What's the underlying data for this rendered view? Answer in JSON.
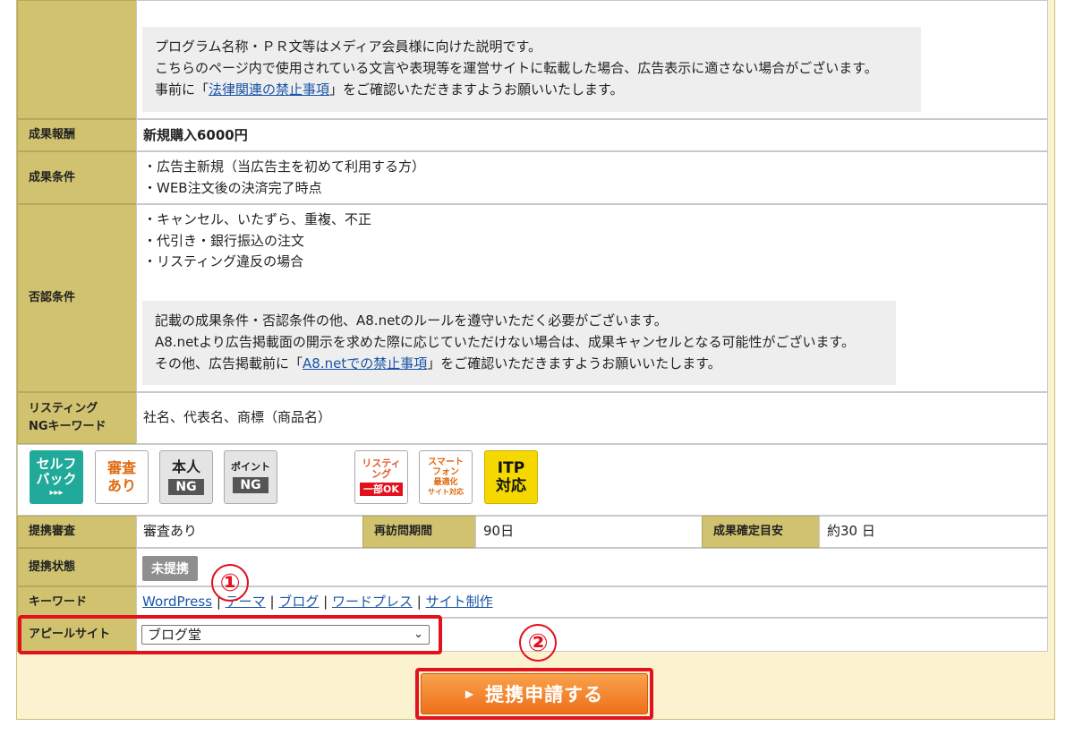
{
  "program_note": {
    "line1": "プログラム名称・ＰＲ文等はメディア会員様に向けた説明です。",
    "line2": "こちらのページ内で使用されている文言や表現等を運営サイトに転載した場合、広告表示に適さない場合がございます。",
    "line3_pre": "事前に「",
    "line3_link": "法律関連の禁止事項",
    "line3_post": "」をご確認いただきますようお願いいたします。"
  },
  "reward": {
    "label": "成果報酬",
    "value": "新規購入6000円"
  },
  "conditions": {
    "label": "成果条件",
    "items": [
      "・広告主新規（当広告主を初めて利用する方）",
      "・WEB注文後の決済完了時点"
    ]
  },
  "rejection": {
    "label": "否認条件",
    "items": [
      "・キャンセル、いたずら、重複、不正",
      "・代引き・銀行振込の注文",
      "・リスティング違反の場合"
    ],
    "note_line1": "記載の成果条件・否認条件の他、A8.netのルールを遵守いただく必要がございます。",
    "note_line2": "A8.netより広告掲載面の開示を求めた際に応じていただけない場合は、成果キャンセルとなる可能性がございます。",
    "note_line3_pre": "その他、広告掲載前に「",
    "note_line3_link": "A8.netでの禁止事項",
    "note_line3_post": "」をご確認いただきますようお願いいたします。"
  },
  "listing_ng": {
    "label_line1": "リスティング",
    "label_line2": "NGキーワード",
    "value": "社名、代表名、商標（商品名）"
  },
  "icons": {
    "selfback": [
      "セルフ",
      "バック",
      "▸▸▸"
    ],
    "review": [
      "審査",
      "あり"
    ],
    "self_ng": [
      "本人",
      "NG"
    ],
    "point_ng": [
      "ポイント",
      "NG"
    ],
    "listing_partial": [
      "リスティ",
      "ング",
      "一部OK"
    ],
    "smartphone": [
      "スマート",
      "フォン",
      "最適化",
      "サイト対応"
    ],
    "itp": [
      "ITP",
      "対応"
    ]
  },
  "terms": {
    "review_label": "提携審査",
    "review_value": "審査あり",
    "revisit_label": "再訪問期間",
    "revisit_value": "90日",
    "confirm_label": "成果確定目安",
    "confirm_value": "約30 日"
  },
  "status": {
    "label": "提携状態",
    "badge": "未提携"
  },
  "keywords": {
    "label": "キーワード",
    "items": [
      "WordPress",
      "テーマ",
      "ブログ",
      "ワードプレス",
      "サイト制作"
    ],
    "sep": "|"
  },
  "appeal_site": {
    "label": "アピールサイト",
    "selected": "ブログ堂"
  },
  "annotations": {
    "one": "①",
    "two": "②"
  },
  "apply_button": {
    "label": "提携申請する"
  },
  "colors": {
    "label_bg": "#d0c26f",
    "accent_red": "#e3101d",
    "button_orange": "#ef6f1a"
  }
}
